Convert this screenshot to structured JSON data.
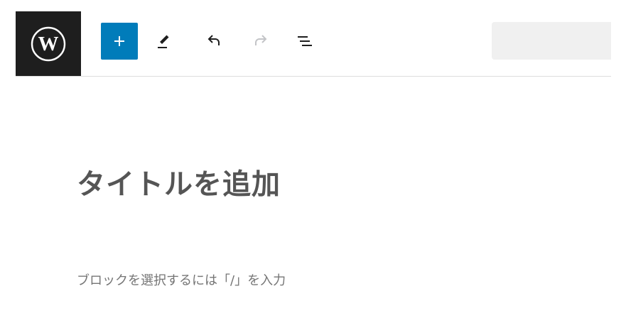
{
  "toolbar": {
    "logo_icon": "wordpress-logo-icon",
    "add_block_icon": "plus-icon",
    "tools_icon": "pencil-icon",
    "undo_icon": "undo-arrow-icon",
    "redo_icon": "redo-arrow-icon",
    "outline_icon": "list-view-icon",
    "redo_enabled": false,
    "colors": {
      "logo_bg": "#1e1e1e",
      "accent": "#007cba",
      "icon": "#1e1e1e",
      "icon_disabled": "#c3c4c7",
      "search_bg": "#f0f0f0"
    }
  },
  "editor": {
    "title_placeholder": "タイトルを追加",
    "block_placeholder": "ブロックを選択するには「/」を入力"
  }
}
